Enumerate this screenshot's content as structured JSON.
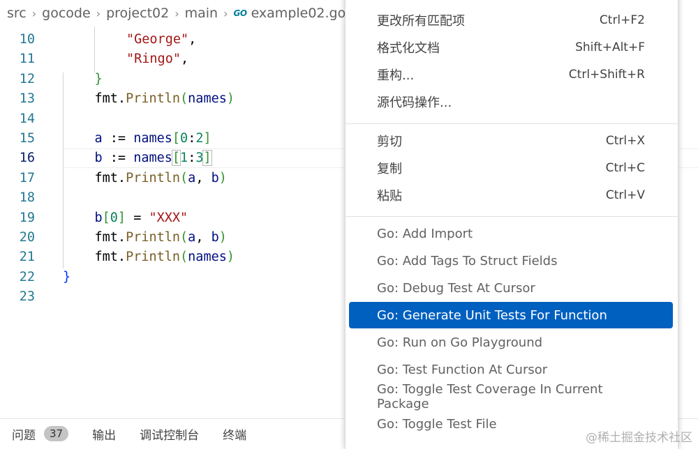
{
  "breadcrumb": {
    "items": [
      "src",
      "gocode",
      "project02",
      "main"
    ],
    "file": "example02.go",
    "file_icon": "GO"
  },
  "editor": {
    "lines": [
      {
        "num": "10",
        "tokens": [
          {
            "t": "\"George\"",
            "c": "s"
          },
          {
            "t": ",",
            "c": ""
          }
        ]
      },
      {
        "num": "11",
        "tokens": [
          {
            "t": "\"Ringo\"",
            "c": "s"
          },
          {
            "t": ",",
            "c": ""
          }
        ]
      },
      {
        "num": "12",
        "tokens": [
          {
            "t": "}",
            "c": "b2"
          }
        ]
      },
      {
        "num": "13",
        "tokens": [
          {
            "t": "fmt.",
            "c": ""
          },
          {
            "t": "Println",
            "c": "f"
          },
          {
            "t": "(",
            "c": "b2"
          },
          {
            "t": "names",
            "c": "v"
          },
          {
            "t": ")",
            "c": "b2"
          }
        ]
      },
      {
        "num": "14",
        "tokens": []
      },
      {
        "num": "15",
        "tokens": [
          {
            "t": "a",
            "c": "v"
          },
          {
            "t": " := ",
            "c": ""
          },
          {
            "t": "names",
            "c": "v"
          },
          {
            "t": "[",
            "c": "b2"
          },
          {
            "t": "0",
            "c": "n"
          },
          {
            "t": ":",
            "c": ""
          },
          {
            "t": "2",
            "c": "n"
          },
          {
            "t": "]",
            "c": "b2"
          }
        ]
      },
      {
        "num": "16",
        "tokens": [
          {
            "t": "b",
            "c": "v"
          },
          {
            "t": " := ",
            "c": ""
          },
          {
            "t": "names",
            "c": "v"
          },
          {
            "t": "[",
            "c": "b2 bm"
          },
          {
            "t": "1",
            "c": "n"
          },
          {
            "t": ":",
            "c": ""
          },
          {
            "t": "3",
            "c": "n"
          },
          {
            "t": "]",
            "c": "b2 bm"
          }
        ]
      },
      {
        "num": "17",
        "tokens": [
          {
            "t": "fmt.",
            "c": ""
          },
          {
            "t": "Println",
            "c": "f"
          },
          {
            "t": "(",
            "c": "b2"
          },
          {
            "t": "a",
            "c": "v"
          },
          {
            "t": ", ",
            "c": ""
          },
          {
            "t": "b",
            "c": "v"
          },
          {
            "t": ")",
            "c": "b2"
          }
        ]
      },
      {
        "num": "18",
        "tokens": []
      },
      {
        "num": "19",
        "tokens": [
          {
            "t": "b",
            "c": "v"
          },
          {
            "t": "[",
            "c": "b2"
          },
          {
            "t": "0",
            "c": "n"
          },
          {
            "t": "]",
            "c": "b2"
          },
          {
            "t": " = ",
            "c": ""
          },
          {
            "t": "\"XXX\"",
            "c": "s"
          }
        ]
      },
      {
        "num": "20",
        "tokens": [
          {
            "t": "fmt.",
            "c": ""
          },
          {
            "t": "Println",
            "c": "f"
          },
          {
            "t": "(",
            "c": "b2"
          },
          {
            "t": "a",
            "c": "v"
          },
          {
            "t": ", ",
            "c": ""
          },
          {
            "t": "b",
            "c": "v"
          },
          {
            "t": ")",
            "c": "b2"
          }
        ]
      },
      {
        "num": "21",
        "tokens": [
          {
            "t": "fmt.",
            "c": ""
          },
          {
            "t": "Println",
            "c": "f"
          },
          {
            "t": "(",
            "c": "b2"
          },
          {
            "t": "names",
            "c": "v"
          },
          {
            "t": ")",
            "c": "b2"
          }
        ]
      },
      {
        "num": "22",
        "tokens": [
          {
            "t": "}",
            "c": "b1"
          }
        ]
      },
      {
        "num": "23",
        "tokens": []
      }
    ],
    "current_line": "16"
  },
  "context_menu": {
    "groups": [
      [
        {
          "label": "更改所有匹配项",
          "shortcut": "Ctrl+F2"
        },
        {
          "label": "格式化文档",
          "shortcut": "Shift+Alt+F"
        },
        {
          "label": "重构...",
          "shortcut": "Ctrl+Shift+R"
        },
        {
          "label": "源代码操作...",
          "shortcut": ""
        }
      ],
      [
        {
          "label": "剪切",
          "shortcut": "Ctrl+X"
        },
        {
          "label": "复制",
          "shortcut": "Ctrl+C"
        },
        {
          "label": "粘贴",
          "shortcut": "Ctrl+V"
        }
      ],
      [
        {
          "label": "Go: Add Import",
          "shortcut": ""
        },
        {
          "label": "Go: Add Tags To Struct Fields",
          "shortcut": ""
        },
        {
          "label": "Go: Debug Test At Cursor",
          "shortcut": ""
        },
        {
          "label": "Go: Generate Unit Tests For Function",
          "shortcut": "",
          "selected": true
        },
        {
          "label": "Go: Run on Go Playground",
          "shortcut": ""
        },
        {
          "label": "Go: Test Function At Cursor",
          "shortcut": ""
        },
        {
          "label": "Go: Toggle Test Coverage In Current Package",
          "shortcut": ""
        },
        {
          "label": "Go: Toggle Test File",
          "shortcut": ""
        }
      ]
    ],
    "selected_bg": "#0060c0"
  },
  "panel": {
    "tabs": [
      {
        "label": "问题",
        "badge": "37"
      },
      {
        "label": "输出"
      },
      {
        "label": "调试控制台"
      },
      {
        "label": "终端"
      }
    ]
  },
  "watermark": "@稀土掘金技术社区"
}
